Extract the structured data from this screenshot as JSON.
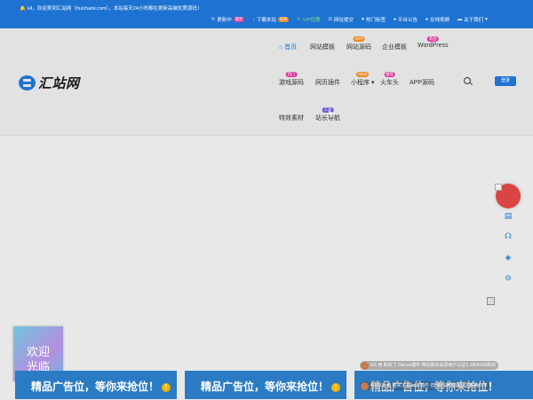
{
  "topbar": {
    "notice": "HI，欢迎来到汇站网（huizhanii.com），本站每天24小时都在更新高端优质源码！",
    "links": [
      {
        "label": "更新中",
        "badge": "最新",
        "icon": "refresh-icon"
      },
      {
        "label": "下载本站",
        "badge": "有效",
        "icon": "download-icon"
      },
      {
        "label": "VIP优惠",
        "icon": "vip-icon"
      },
      {
        "label": "网址提交",
        "icon": "submit-icon"
      },
      {
        "label": "热门标签",
        "icon": "tag-icon"
      },
      {
        "label": "平台公告",
        "icon": "notice-icon"
      },
      {
        "label": "在线视频",
        "icon": "video-icon"
      },
      {
        "label": "关于我们",
        "icon": "about-icon"
      }
    ]
  },
  "logo": {
    "text": "汇站网"
  },
  "nav": {
    "home": "首页",
    "templates": "网站模板",
    "source": "网站源码",
    "source_badge": "HOT",
    "enterprise": "企业模板",
    "wordpress": "WordPress",
    "wordpress_badge": "新品",
    "game": "游戏源码",
    "game_badge": "热门",
    "plugins": "网页插件",
    "mini": "小程序",
    "mini_badge": "NEW",
    "huoche": "火车头",
    "huoche_badge": "推荐",
    "app": "APP源码",
    "effects": "特效素材",
    "tools": "站长导航",
    "tools_badge": "工具"
  },
  "login_label": "登录",
  "welcome": {
    "line1": "欢迎",
    "line2": "光临"
  },
  "ads": [
    {
      "label": "精品广告位，等你来抢位！"
    },
    {
      "label": "精品广告位，等你来抢位！"
    },
    {
      "label": "精品广告位，等你来抢位！"
    }
  ],
  "tickers": [
    {
      "text": "4.5 用 购买了 Discuz插件 微信购买会员用户认证1.1804166购买"
    },
    {
      "text": "4.10.00 用 购买了 Discuz插件 仿HEPC教程网社区数据小库"
    }
  ],
  "colors": {
    "primary": "#1e73d2",
    "ad": "#2b7bc4",
    "red_float": "#d94545"
  }
}
